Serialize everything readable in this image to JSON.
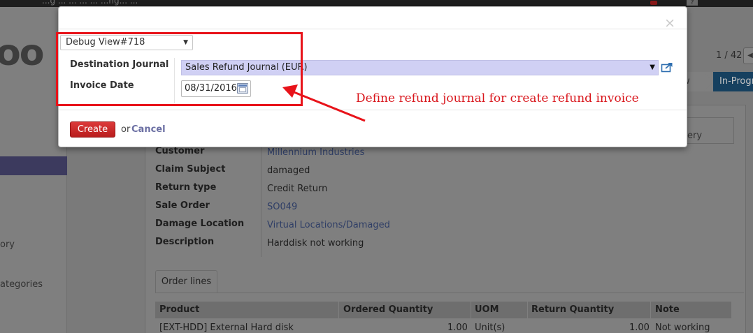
{
  "topbar": {
    "text": "...g ... ... ... ... ...ng... ...",
    "icon_badge": "?"
  },
  "sidebar": {
    "logo": "oo",
    "items": [
      {
        "label": "ory"
      },
      {
        "label": "ategories"
      }
    ]
  },
  "record": {
    "pager": "1 / 42",
    "statusbar": {
      "previous": "ew",
      "active": "In-Progr"
    },
    "smart_box_label": "ery",
    "fields": [
      {
        "label": "Customer",
        "value": "Millennium Industries",
        "link": true
      },
      {
        "label": "Claim Subject",
        "value": "damaged",
        "link": false
      },
      {
        "label": "Return type",
        "value": "Credit Return",
        "link": false
      },
      {
        "label": "Sale Order",
        "value": "SO049",
        "link": true
      },
      {
        "label": "Damage Location",
        "value": "Virtual Locations/Damaged",
        "link": true
      },
      {
        "label": "Description",
        "value": "Harddisk not working",
        "link": false
      }
    ],
    "tab_label": "Order lines",
    "order_lines": {
      "columns": [
        "Product",
        "Ordered Quantity",
        "UOM",
        "Return Quantity",
        "Note"
      ],
      "rows": [
        [
          "[EXT-HDD] External Hard disk",
          "1.00",
          "Unit(s)",
          "1.00",
          "Not working"
        ]
      ]
    }
  },
  "dialog": {
    "debug_view": "Debug View#718",
    "close_glyph": "×",
    "destination_journal_label": "Destination Journal",
    "destination_journal_value": "Sales Refund Journal (EUR)",
    "invoice_date_label": "Invoice Date",
    "invoice_date_value": "08/31/2016",
    "create_label": "Create",
    "or_text": "or",
    "cancel_label": "Cancel"
  },
  "annotation": {
    "text": "Define refund journal for create refund invoice",
    "color": "#d9161c"
  },
  "colors": {
    "create_button": "#c62828",
    "journal_highlight": "#d0d0f4",
    "status_active": "#16405f"
  }
}
